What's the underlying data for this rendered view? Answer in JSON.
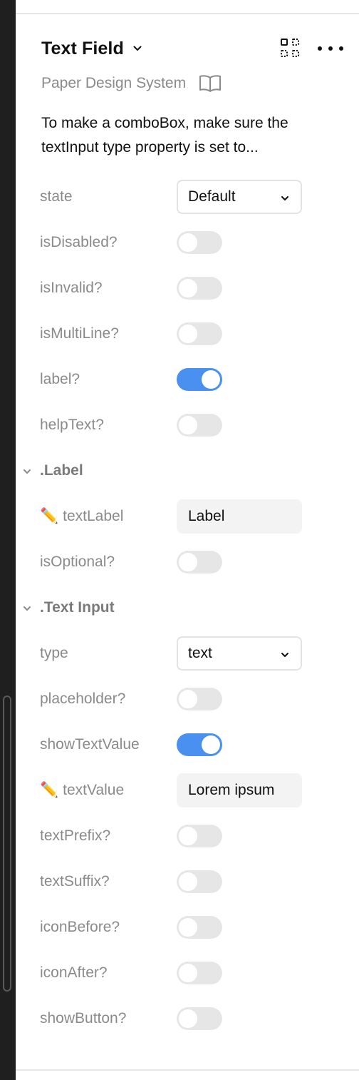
{
  "header": {
    "title": "Text Field",
    "subtitle": "Paper Design System",
    "description": "To make a comboBox, make sure the textInput type property is set to..."
  },
  "properties": {
    "state": {
      "label": "state",
      "value": "Default"
    },
    "isDisabled": {
      "label": "isDisabled?",
      "on": false
    },
    "isInvalid": {
      "label": "isInvalid?",
      "on": false
    },
    "isMultiLine": {
      "label": "isMultiLine?",
      "on": false
    },
    "label": {
      "label": "label?",
      "on": true
    },
    "helpText": {
      "label": "helpText?",
      "on": false
    }
  },
  "sections": {
    "label": {
      "title": ".Label",
      "textLabel": {
        "label": "textLabel",
        "value": "Label"
      },
      "isOptional": {
        "label": "isOptional?",
        "on": false
      }
    },
    "textInput": {
      "title": ".Text Input",
      "type": {
        "label": "type",
        "value": "text"
      },
      "placeholder": {
        "label": "placeholder?",
        "on": false
      },
      "showTextValue": {
        "label": "showTextValue",
        "on": true
      },
      "textValue": {
        "label": "textValue",
        "value": "Lorem ipsum"
      },
      "textPrefix": {
        "label": "textPrefix?",
        "on": false
      },
      "textSuffix": {
        "label": "textSuffix?",
        "on": false
      },
      "iconBefore": {
        "label": "iconBefore?",
        "on": false
      },
      "iconAfter": {
        "label": "iconAfter?",
        "on": false
      },
      "showButton": {
        "label": "showButton?",
        "on": false
      }
    }
  },
  "icons": {
    "title_dropdown": "chevron-down-icon",
    "component_grid": "component-grid-icon",
    "more": "more-horizontal-icon",
    "docs": "book-icon",
    "section_collapse": "chevron-down-icon",
    "text_property": "pencil-icon"
  },
  "colors": {
    "toggle_on": "#4a90f0",
    "toggle_off": "#e6e6e6",
    "label_gray": "#8a8a8a",
    "text": "#111111"
  }
}
